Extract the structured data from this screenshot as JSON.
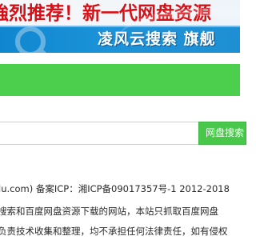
{
  "banner": {
    "slogan": "強烈推荐！新一代网盘资源",
    "brand": "凌风云搜索 旗舰",
    "colors": {
      "slogan": "#d70f16",
      "background": "#1c93d8",
      "strip": "#f6f7f9"
    },
    "icon": "search-icon"
  },
  "nav_bar": {
    "color": "#4ccf4c"
  },
  "search": {
    "input_value": "",
    "placeholder": "",
    "button_label": "网盘搜索",
    "button_color": "#49c74b"
  },
  "footer": {
    "line1": "lu.com) 备案ICP：湘ICP备09017357号-1 2012-2018",
    "line2": "搜索和百度网盘资源下载的网站，本站只抓取百度网盘",
    "line3": "负责技术收集和整理，均不承担任何法律责任，如有侵权"
  }
}
